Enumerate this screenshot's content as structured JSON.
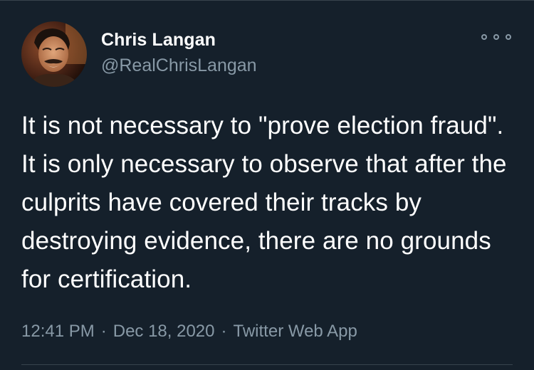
{
  "author": {
    "name": "Chris Langan",
    "handle": "@RealChrisLangan"
  },
  "tweet": {
    "text": "It is not necessary to \"prove election fraud\". It is only necessary to observe that after the culprits have covered their tracks by destroying evidence, there are no grounds for certification.",
    "time": "12:41 PM",
    "date": "Dec 18, 2020",
    "source": "Twitter Web App",
    "separator": "·"
  },
  "colors": {
    "background": "#15202b",
    "primary_text": "#ffffff",
    "secondary_text": "#8899a6",
    "divider": "#38444d"
  },
  "icons": {
    "more": "more-options-icon"
  }
}
